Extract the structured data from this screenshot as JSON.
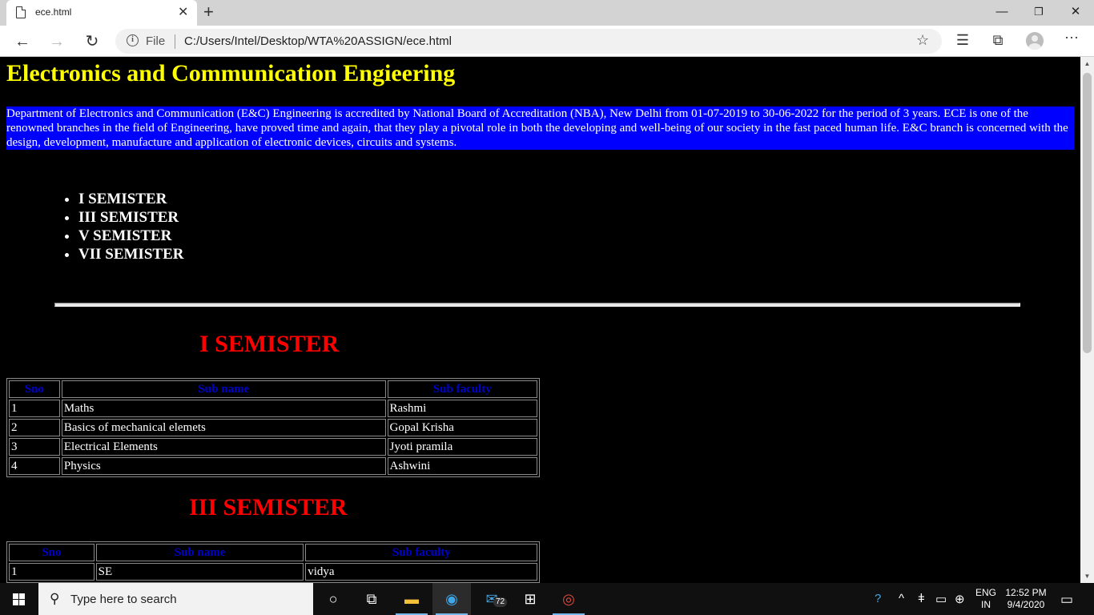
{
  "browser": {
    "tab_title": "ece.html",
    "tab_close": "✕",
    "new_tab": "+",
    "window_controls": {
      "minimize": "—",
      "restore": "❐",
      "close": "✕"
    },
    "address_scheme": "File",
    "address_url": "C:/Users/Intel/Desktop/WTA%20ASSIGN/ece.html",
    "icons": [
      "back-icon",
      "forward-icon",
      "refresh-icon",
      "info-icon",
      "favorite-star-icon",
      "favorites-list-icon",
      "collections-icon",
      "profile-avatar-icon",
      "more-menu-icon"
    ]
  },
  "page": {
    "title": "Electronics and Communication Engieering",
    "intro": "Department of Electronics and Communication (E&C) Engineering is accredited by National Board of Accreditation (NBA), New Delhi from 01-07-2019 to 30-06-2022 for the period of 3 years. ECE is one of the renowned branches in the field of Engineering, have proved time and again, that they play a pivotal role in both the developing and well-being of our society in the fast paced human life. E&C branch is concerned with the design, development, manufacture and application of electronic devices, circuits and systems.",
    "semester_links": [
      "I SEMISTER",
      "III SEMISTER",
      "V SEMISTER",
      "VII SEMISTER"
    ],
    "semesters": [
      {
        "heading": "I SEMISTER",
        "columns": [
          "Sno",
          "Sub name",
          "Sub faculty"
        ],
        "rows": [
          [
            "1",
            "Maths",
            "Rashmi"
          ],
          [
            "2",
            "Basics of mechanical elemets",
            "Gopal Krisha"
          ],
          [
            "3",
            "Electrical Elements",
            "Jyoti pramila"
          ],
          [
            "4",
            "Physics",
            "Ashwini"
          ]
        ]
      },
      {
        "heading": "III SEMISTER",
        "columns": [
          "Sno",
          "Sub name",
          "Sub faculty"
        ],
        "rows": [
          [
            "1",
            "SE",
            "vidya"
          ]
        ]
      }
    ],
    "colors": {
      "background": "#000000",
      "title": "#ffff00",
      "intro_bg": "#0000ff",
      "heading": "#ff0000",
      "table_header": "#0000cc"
    }
  },
  "taskbar": {
    "search_placeholder": "Type here to search",
    "mail_badge": "72",
    "language": "ENG",
    "region": "IN",
    "time": "12:52 PM",
    "date": "9/4/2020"
  }
}
